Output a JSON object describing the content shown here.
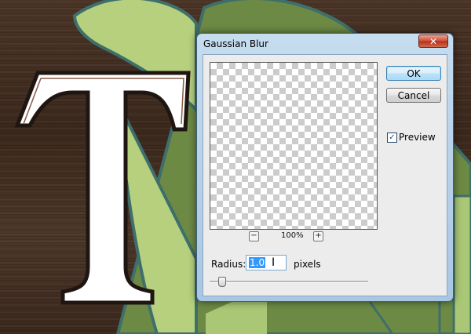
{
  "background": {
    "artwork_letter": "T"
  },
  "dialog": {
    "title": "Gaussian Blur",
    "close_glyph": "✕",
    "zoom_level": "100%",
    "zoom_out_glyph": "−",
    "zoom_in_glyph": "+",
    "ok_label": "OK",
    "cancel_label": "Cancel",
    "preview_label": "Preview",
    "preview_checked": true,
    "check_glyph": "✓",
    "radius_label": "Radius:",
    "radius_value": "1.0",
    "radius_unit": "pixels",
    "cursor_glyph": "I"
  },
  "colors": {
    "leaf_green": "#b6d07e",
    "dark_olive": "#6d8a45",
    "outline_teal": "#3e6f6a",
    "wood_brown": "#422e21",
    "titlebar_blue": "#b8d2ea",
    "selection_blue": "#3399ff"
  }
}
